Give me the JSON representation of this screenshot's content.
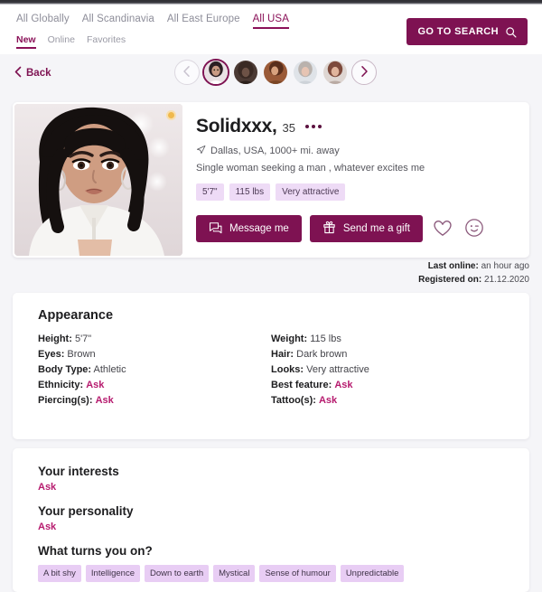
{
  "header": {
    "primary_nav": [
      {
        "label": "All Globally",
        "active": false
      },
      {
        "label": "All Scandinavia",
        "active": false
      },
      {
        "label": "All East Europe",
        "active": false
      },
      {
        "label": "All USA",
        "active": true
      }
    ],
    "secondary_nav": [
      {
        "label": "New",
        "active": true
      },
      {
        "label": "Online",
        "active": false
      },
      {
        "label": "Favorites",
        "active": false
      }
    ],
    "search_button": "GO TO SEARCH",
    "search_icon": "search-icon"
  },
  "subbar": {
    "back_label": "Back",
    "back_icon": "chevron-left-icon",
    "prev_icon": "chevron-left-circle-icon",
    "next_icon": "chevron-right-circle-icon",
    "avatars": [
      {
        "name": "avatar-1",
        "active": true
      },
      {
        "name": "avatar-2",
        "active": false
      },
      {
        "name": "avatar-3",
        "active": false
      },
      {
        "name": "avatar-4",
        "active": false
      },
      {
        "name": "avatar-5",
        "active": false
      }
    ]
  },
  "profile": {
    "photo_badge_color": "#f0b94c",
    "name": "Solidxxx,",
    "age": "35",
    "more_icon": "more-horizontal-icon",
    "location_icon": "location-arrow-icon",
    "location": "Dallas, USA, 1000+ mi. away",
    "seeking": "Single woman seeking a man , whatever excites me",
    "chips": [
      "5'7\"",
      "115 lbs",
      "Very attractive"
    ],
    "message_button": "Message me",
    "message_icon": "chat-bubbles-icon",
    "gift_button": "Send me a gift",
    "gift_icon": "gift-icon",
    "favorite_icon": "heart-outline-icon",
    "wink_icon": "wink-smiley-icon",
    "last_online_label": "Last online:",
    "last_online_value": "an hour ago",
    "registered_label": "Registered on:",
    "registered_value": "21.12.2020"
  },
  "appearance": {
    "title": "Appearance",
    "left_column": [
      {
        "label": "Height:",
        "value": "5'7\"",
        "ask": false
      },
      {
        "label": "Eyes:",
        "value": "Brown",
        "ask": false
      },
      {
        "label": "Body Type:",
        "value": "Athletic",
        "ask": false
      },
      {
        "label": "Ethnicity:",
        "value": "Ask",
        "ask": true
      },
      {
        "label": "Piercing(s):",
        "value": "Ask",
        "ask": true
      }
    ],
    "right_column": [
      {
        "label": "Weight:",
        "value": "115 lbs",
        "ask": false
      },
      {
        "label": "Hair:",
        "value": "Dark brown",
        "ask": false
      },
      {
        "label": "Looks:",
        "value": "Very attractive",
        "ask": false
      },
      {
        "label": "Best feature:",
        "value": "Ask",
        "ask": true
      },
      {
        "label": "Tattoo(s):",
        "value": "Ask",
        "ask": true
      }
    ]
  },
  "about": {
    "interests_title": "Your interests",
    "interests_value": "Ask",
    "personality_title": "Your personality",
    "personality_value": "Ask",
    "turnons_title": "What turns you on?",
    "turnons": [
      "A bit shy",
      "Intelligence",
      "Down to earth",
      "Mystical",
      "Sense of humour",
      "Unpredictable"
    ]
  },
  "colors": {
    "brand": "#7e1252",
    "accent_pink": "#b61a6e",
    "chip_bg": "#eedbf6",
    "page_bg": "#f5f5f8"
  }
}
